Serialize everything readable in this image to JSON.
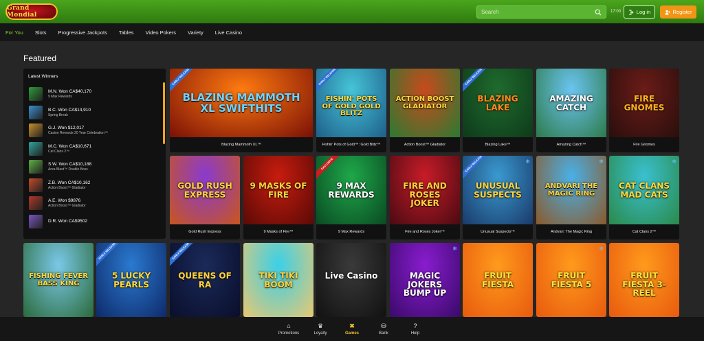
{
  "header": {
    "logo_text": "Grand Mondial",
    "search_placeholder": "Search",
    "time": "17:00",
    "login_label": "Log in",
    "register_label": "Register"
  },
  "nav": {
    "items": [
      "For You",
      "Slots",
      "Progressive Jackpots",
      "Tables",
      "Video Pokers",
      "Variety",
      "Live Casino"
    ],
    "active": "For You"
  },
  "featured": {
    "title": "Featured",
    "winners_title": "Latest Winners",
    "winners": [
      {
        "name": "M.N. Won CA$40,170",
        "game": "9 Max Rewards",
        "color": "#2f9c3a"
      },
      {
        "name": "B.C. Won CA$14,910",
        "game": "Spring Break",
        "color": "#3a8fd0"
      },
      {
        "name": "G.J. Won $12,017",
        "game": "Casino Rewards 20 Year Celebration™",
        "color": "#c8902c"
      },
      {
        "name": "M.C. Won CA$10,671",
        "game": "Cat Clans 2™",
        "color": "#2fa39b"
      },
      {
        "name": "S.W. Won CA$10,188",
        "game": "Area Blast™ Double Boss",
        "color": "#5fb043"
      },
      {
        "name": "Z.B. Won CA$10,162",
        "game": "Action Boost™ Gladiator",
        "color": "#c44a2a"
      },
      {
        "name": "A.E. Won $9876",
        "game": "Action Boost™ Gladiator",
        "color": "#b2382a"
      },
      {
        "name": "D.R. Won CA$9502",
        "game": "",
        "color": "#7a55c2"
      }
    ]
  },
  "tiles": [
    {
      "name": "Blazing Mammoth XL™",
      "art": "BLAZING MAMMOTH XL SWIFTHITS",
      "ribbon": "EARLY RELEASE",
      "ribbon_color": "blue",
      "bg": [
        "#ff7a10",
        "#7a1006"
      ],
      "title_color": "#6fd4ff"
    },
    {
      "name": "Fishin' Pots of Gold™: Gold Blitz™",
      "art": "FISHIN' POTS OF GOLD GOLD BLITZ",
      "ribbon": "EARLY RELEASE",
      "ribbon_color": "blue",
      "bg": [
        "#46c4d8",
        "#1e5f8a"
      ],
      "title_color": "#ffd93b"
    },
    {
      "name": "Action Boost™ Gladiator",
      "art": "ACTION BOOST GLADIATOR",
      "ribbon": "",
      "bg": [
        "#c84a1c",
        "#2a7a32"
      ],
      "title_color": "#ffd93b"
    },
    {
      "name": "Blazing Lake™",
      "art": "BLAZING LAKE",
      "ribbon": "EARLY RELEASE",
      "ribbon_color": "blue",
      "bg": [
        "#1f6b2e",
        "#0e3a1a"
      ],
      "title_color": "#ff8a1c"
    },
    {
      "name": "Amazing Catch™",
      "art": "AMAZING CATCH",
      "ribbon": "",
      "bg": [
        "#6ac4f0",
        "#2d7a4a"
      ],
      "title_color": "#ffffff"
    },
    {
      "name": "Fire Gnomes",
      "art": "FIRE GNOMES",
      "ribbon": "",
      "bg": [
        "#6a1c18",
        "#2a0e0c"
      ],
      "title_color": "#ffb21c"
    },
    {
      "name": "Gold Rush Express",
      "art": "GOLD RUSH EXPRESS",
      "ribbon": "",
      "bg": [
        "#8a3ad0",
        "#c8561c"
      ],
      "title_color": "#ffd23b"
    },
    {
      "name": "9 Masks of Fire™",
      "art": "9 MASKS OF FIRE",
      "ribbon": "",
      "bg": [
        "#c81c0e",
        "#5a0a06"
      ],
      "title_color": "#ffd23b"
    },
    {
      "name": "9 Max Rewards",
      "art": "9 MAX REWARDS",
      "ribbon": "EXCLUSIVE",
      "ribbon_color": "red",
      "bg": [
        "#1ea84a",
        "#0a4a22"
      ],
      "title_color": "#ffffff"
    },
    {
      "name": "Fire and Roses Joker™",
      "art": "FIRE AND ROSES JOKER",
      "ribbon": "",
      "bg": [
        "#c81c28",
        "#4a0a12"
      ],
      "title_color": "#ffd23b"
    },
    {
      "name": "Unusual Suspects™",
      "art": "UNUSUAL SUSPECTS",
      "ribbon": "EARLY RELEASE",
      "ribbon_color": "blue",
      "bg": [
        "#3a9ad0",
        "#1a3a6a"
      ],
      "title_color": "#ffd23b",
      "snow": true
    },
    {
      "name": "Andvari: The Magic Ring",
      "art": "ANDVARI THE MAGIC RING",
      "ribbon": "",
      "bg": [
        "#4ab0e8",
        "#8a5a2a"
      ],
      "title_color": "#ffd23b",
      "snow": true
    },
    {
      "name": "Cat Clans 2™",
      "art": "CAT CLANS MAD CATS",
      "ribbon": "",
      "bg": [
        "#3ac0d0",
        "#2a8a4a"
      ],
      "title_color": "#ffd93b",
      "snow": true
    },
    {
      "name": "",
      "art": "FISHING FEVER BASS KING",
      "ribbon": "",
      "bg": [
        "#7ac8e8",
        "#2a6a3a"
      ],
      "title_color": "#ffd93b"
    },
    {
      "name": "",
      "art": "5 LUCKY PEARLS",
      "ribbon": "EARLY RELEASE",
      "ribbon_color": "blue",
      "bg": [
        "#2a7ad0",
        "#0e2a6a"
      ],
      "title_color": "#ffd93b"
    },
    {
      "name": "",
      "art": "QUEENS OF RA",
      "ribbon": "EARLY RELEASE",
      "ribbon_color": "blue",
      "bg": [
        "#1a2a5a",
        "#0a0e2a"
      ],
      "title_color": "#ffd23b"
    },
    {
      "name": "",
      "art": "TIKI TIKI BOOM",
      "ribbon": "",
      "bg": [
        "#3ad0e8",
        "#e8c872"
      ],
      "title_color": "#ffd23b"
    },
    {
      "name": "",
      "art": "Live Casino",
      "ribbon": "",
      "bg": [
        "#3a3a3a",
        "#111111"
      ],
      "title_color": "#ffffff"
    },
    {
      "name": "",
      "art": "MAGIC JOKERS BUMP UP",
      "ribbon": "",
      "bg": [
        "#8a1cd0",
        "#3a0a6a"
      ],
      "title_color": "#ffffff",
      "snow": true
    },
    {
      "name": "",
      "art": "FRUIT FIESTA",
      "ribbon": "",
      "bg": [
        "#ff9a1c",
        "#e85a0e"
      ],
      "title_color": "#ffe23b"
    },
    {
      "name": "",
      "art": "FRUIT FIESTA 5",
      "ribbon": "",
      "bg": [
        "#ff9a1c",
        "#e85a0e"
      ],
      "title_color": "#ffe23b",
      "snow": true
    },
    {
      "name": "",
      "art": "FRUIT FIESTA 3-REEL",
      "ribbon": "",
      "bg": [
        "#ff9a1c",
        "#e85a0e"
      ],
      "title_color": "#ffe23b"
    }
  ],
  "bottom_nav": {
    "items": [
      {
        "label": "Promotions",
        "icon": "home-icon"
      },
      {
        "label": "Loyalty",
        "icon": "crown-icon"
      },
      {
        "label": "Games",
        "icon": "games-icon"
      },
      {
        "label": "Bank",
        "icon": "bank-icon"
      },
      {
        "label": "Help",
        "icon": "help-icon"
      }
    ],
    "active": "Games"
  }
}
